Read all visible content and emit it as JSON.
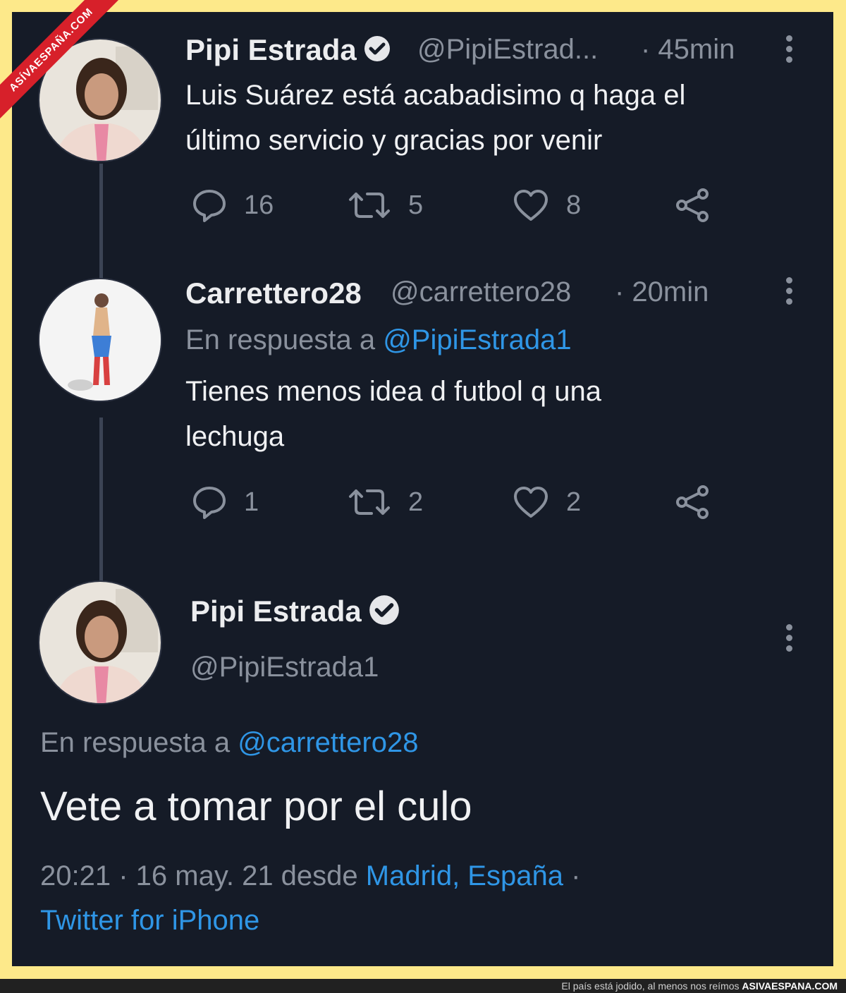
{
  "watermark": "ASÍVAESPAÑA.COM",
  "tweets": [
    {
      "name": "Pipi Estrada",
      "handle": "@PipiEstrad...",
      "time": "· 45min",
      "text_lines": [
        "Luis Suárez está acabadisimo q haga el",
        "último servicio y gracias por venir"
      ],
      "replies": "16",
      "retweets": "5",
      "likes": "8",
      "verified": true
    },
    {
      "name": "Carrettero28",
      "handle": "@carrettero28",
      "time": "· 20min",
      "reply_prefix": "En respuesta a",
      "reply_to": "@PipiEstrada1",
      "text_lines": [
        "Tienes menos idea d futbol q una",
        "lechuga"
      ],
      "replies": "1",
      "retweets": "2",
      "likes": "2"
    }
  ],
  "main_tweet": {
    "name": "Pipi Estrada",
    "handle": "@PipiEstrada1",
    "reply_prefix": "En respuesta a",
    "reply_to": "@carrettero28",
    "text": "Vete a tomar por el culo",
    "datetime": "20:21 · 16 may. 21 desde",
    "location": "Madrid, España",
    "separator": "·",
    "source": "Twitter for iPhone",
    "verified": true
  },
  "footer": {
    "tagline": "El país está jodido, al menos nos reímos",
    "site": "ASIVAESPANA.COM"
  },
  "colors": {
    "background": "#151b27",
    "border": "#fde98a",
    "link": "#2f96e6",
    "muted": "#8a919d",
    "text": "#f0f1f3"
  },
  "icons": [
    "reply-icon",
    "retweet-icon",
    "like-icon",
    "share-icon",
    "verified-badge-icon",
    "more-vertical-icon"
  ]
}
